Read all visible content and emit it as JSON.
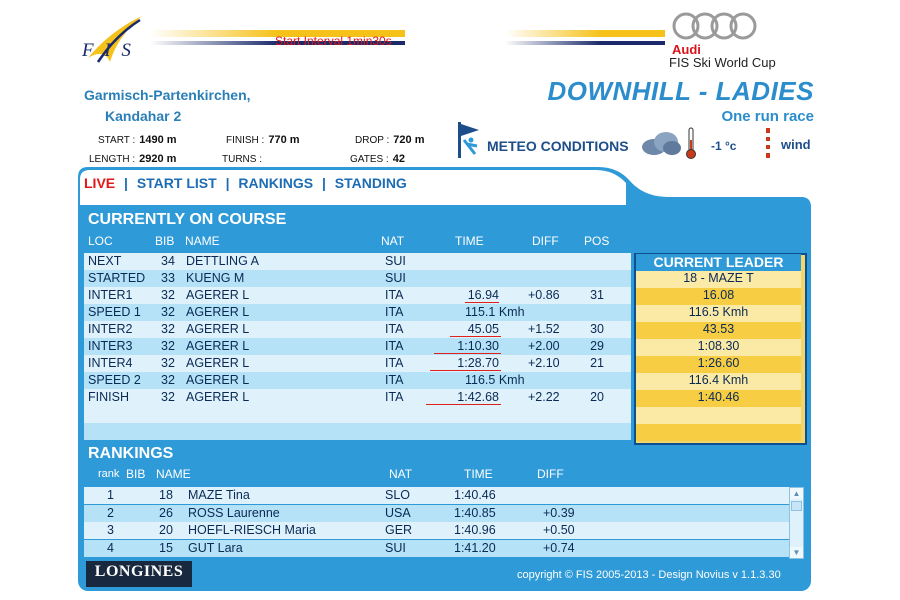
{
  "header": {
    "fis_logo_text": "F I S",
    "start_interval": "Start Interval 1min30s",
    "sponsor_brand": "Audi",
    "sponsor_title": "FIS Ski World Cup"
  },
  "venue": {
    "location": "Garmisch-Partenkirchen,",
    "course": "Kandahar 2",
    "start_label": "START :",
    "start_value": "1490 m",
    "finish_label": "FINISH :",
    "finish_value": "770 m",
    "drop_label": "DROP :",
    "drop_value": "720 m",
    "length_label": "LENGTH :",
    "length_value": "2920 m",
    "turns_label": "TURNS :",
    "turns_value": "",
    "gates_label": "GATES :",
    "gates_value": "42"
  },
  "event": {
    "title": "DOWNHILL - LADIES",
    "run_type": "One run race"
  },
  "meteo": {
    "label": "METEO CONDITIONS",
    "temperature": "-1 °c",
    "wind": "wind",
    "icons": [
      "skier-flag-icon",
      "cloud-icon",
      "thermometer-icon",
      "windsock-icon"
    ]
  },
  "nav": {
    "live": "LIVE",
    "start_list": "START LIST",
    "rankings": "RANKINGS",
    "standing": "STANDING",
    "separator": "|"
  },
  "course": {
    "title": "CURRENTLY ON COURSE",
    "columns": {
      "loc": "LOC",
      "bib": "BIB",
      "name": "NAME",
      "nat": "NAT",
      "time": "TIME",
      "diff": "DIFF",
      "pos": "POS"
    },
    "rows": [
      {
        "loc": "NEXT",
        "bib": "34",
        "name": "DETTLING A",
        "nat": "SUI",
        "time": "",
        "diff": "",
        "pos": ""
      },
      {
        "loc": "STARTED",
        "bib": "33",
        "name": "KUENG M",
        "nat": "SUI",
        "time": "",
        "diff": "",
        "pos": ""
      },
      {
        "loc": "INTER1",
        "bib": "32",
        "name": "AGERER L",
        "nat": "ITA",
        "time": "16.94",
        "diff": "+0.86",
        "pos": "31"
      },
      {
        "loc": "SPEED 1",
        "bib": "32",
        "name": "AGERER L",
        "nat": "ITA",
        "time": "115.1  Kmh",
        "diff": "",
        "pos": ""
      },
      {
        "loc": "INTER2",
        "bib": "32",
        "name": "AGERER L",
        "nat": "ITA",
        "time": "45.05",
        "diff": "+1.52",
        "pos": "30"
      },
      {
        "loc": "INTER3",
        "bib": "32",
        "name": "AGERER L",
        "nat": "ITA",
        "time": "1:10.30",
        "diff": "+2.00",
        "pos": "29"
      },
      {
        "loc": "INTER4",
        "bib": "32",
        "name": "AGERER L",
        "nat": "ITA",
        "time": "1:28.70",
        "diff": "+2.10",
        "pos": "21"
      },
      {
        "loc": "SPEED 2",
        "bib": "32",
        "name": "AGERER L",
        "nat": "ITA",
        "time": "116.5  Kmh",
        "diff": "",
        "pos": ""
      },
      {
        "loc": "FINISH",
        "bib": "32",
        "name": "AGERER L",
        "nat": "ITA",
        "time": "1:42.68",
        "diff": "+2.22",
        "pos": "20"
      }
    ]
  },
  "leader": {
    "title": "CURRENT LEADER",
    "rows": [
      "18 - MAZE T",
      "16.08",
      "116.5  Kmh",
      "43.53",
      "1:08.30",
      "1:26.60",
      "116.4  Kmh",
      "1:40.46"
    ]
  },
  "rankings": {
    "title": "RANKINGS",
    "columns": {
      "rank": "rank",
      "bib": "BIB",
      "name": "NAME",
      "nat": "NAT",
      "time": "TIME",
      "diff": "DIFF"
    },
    "rows": [
      {
        "rank": "1",
        "bib": "18",
        "name": "MAZE Tina",
        "nat": "SLO",
        "time": "1:40.46",
        "diff": ""
      },
      {
        "rank": "2",
        "bib": "26",
        "name": "ROSS Laurenne",
        "nat": "USA",
        "time": "1:40.85",
        "diff": "+0.39"
      },
      {
        "rank": "3",
        "bib": "20",
        "name": "HOEFL-RIESCH Maria",
        "nat": "GER",
        "time": "1:40.96",
        "diff": "+0.50"
      },
      {
        "rank": "4",
        "bib": "15",
        "name": "GUT Lara",
        "nat": "SUI",
        "time": "1:41.20",
        "diff": "+0.74"
      }
    ]
  },
  "footer": {
    "longines": "LONGINES",
    "copyright": "copyright © FIS 2005-2013 - Design Novius  v 1.1.3.30"
  },
  "colors": {
    "accent_blue": "#2f9ad8",
    "live_red": "#e01818",
    "leader_yellow": "#f7cd44"
  }
}
